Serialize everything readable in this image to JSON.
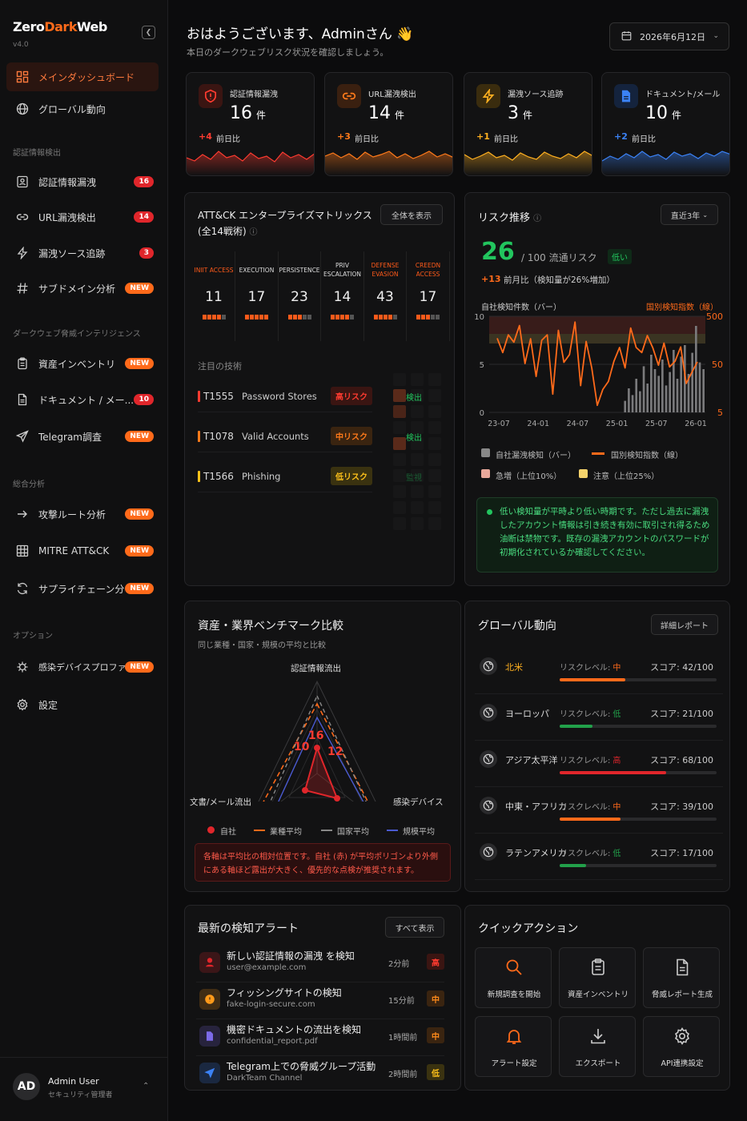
{
  "app": {
    "logo_a": "Zero",
    "logo_b": "Dark",
    "logo_c": "Web",
    "version": "v4.0"
  },
  "nav": {
    "items": [
      {
        "label": "メインダッシュボード"
      },
      {
        "label": "グローバル動向"
      },
      {
        "label": "認証情報漏洩",
        "badge": "16"
      },
      {
        "label": "URL漏洩検出",
        "badge": "14"
      },
      {
        "label": "漏洩ソース追跡",
        "badge": "3"
      },
      {
        "label": "サブドメイン分析",
        "badge": "NEW"
      },
      {
        "label": "資産インベントリ",
        "badge": "NEW"
      },
      {
        "label": "ドキュメント / メー...",
        "badge": "10"
      },
      {
        "label": "Telegram調査",
        "badge": "NEW"
      },
      {
        "label": "攻撃ルート分析",
        "badge": "NEW"
      },
      {
        "label": "MITRE ATT&CK",
        "badge": "NEW"
      },
      {
        "label": "サプライチェーン分析",
        "badge": "NEW"
      },
      {
        "label": "感染デバイスプロファイル",
        "badge": "NEW"
      },
      {
        "label": "設定"
      }
    ],
    "sections": [
      "認証情報検出",
      "ダークウェブ脅威インテリジェンス",
      "総合分析",
      "オプション"
    ]
  },
  "user": {
    "initials": "AD",
    "name": "Admin User",
    "role": "セキュリティ管理者"
  },
  "header": {
    "greeting": "おはようございます、Adminさん 👋",
    "subtitle": "本日のダークウェブリスク状況を確認しましょう。",
    "date": "2026年6月12日"
  },
  "stats": [
    {
      "title": "認証情報漏洩",
      "value": "16",
      "unit": "件",
      "delta": "+4",
      "delta_label": "前日比",
      "color": "#ff3b30"
    },
    {
      "title": "URL漏洩検出",
      "value": "14",
      "unit": "件",
      "delta": "+3",
      "delta_label": "前日比",
      "color": "#ff7a1a"
    },
    {
      "title": "漏洩ソース追跡",
      "value": "3",
      "unit": "件",
      "delta": "+1",
      "delta_label": "前日比",
      "color": "#ffb020"
    },
    {
      "title": "ドキュメント/メール",
      "value": "10",
      "unit": "件",
      "delta": "+2",
      "delta_label": "前日比",
      "color": "#3b82f6"
    }
  ],
  "attack": {
    "title": "ATT&CK エンタープライズマトリックス",
    "subtitle": "(全14戦術)",
    "button": "全体を表示",
    "tactics": [
      {
        "name": "INIIT ACCESS",
        "value": "11",
        "red": true,
        "bars": 4
      },
      {
        "name": "EXECUTION",
        "value": "17",
        "red": false,
        "bars": 5
      },
      {
        "name": "PERSISTENCE",
        "value": "23",
        "red": false,
        "bars": 3
      },
      {
        "name": "PRIV ESCALATION",
        "value": "14",
        "red": false,
        "bars": 4
      },
      {
        "name": "DEFENSE EVASION",
        "value": "43",
        "red": true,
        "bars": 4
      },
      {
        "name": "CREEDN ACCESS",
        "value": "17",
        "red": true,
        "bars": 3
      }
    ],
    "focus_title": "注目の技術",
    "techniques": [
      {
        "id": "T1555",
        "name": "Password Stores",
        "risk": "高リスク",
        "status": "検出",
        "color": "#ff3b30"
      },
      {
        "id": "T1078",
        "name": "Valid Accounts",
        "risk": "中リスク",
        "status": "検出",
        "color": "#ff7a1a"
      },
      {
        "id": "T1566",
        "name": "Phishing",
        "risk": "低リスク",
        "status": "監視",
        "color": "#ffc21a"
      }
    ]
  },
  "risk": {
    "title": "リスク推移",
    "period": "直近3年",
    "score": "26",
    "score_label": "/ 100 流通リスク",
    "level": "低い",
    "delta": "+13",
    "delta_label": "前月比（検知量が26%増加）",
    "bar_axis_label": "自社検知件数（バー）",
    "line_axis_label": "国別検知指数（線）",
    "legend": [
      "自社漏洩検知（バー）",
      "国別検知指数（線）",
      "急増（上位10%）",
      "注意（上位25%）"
    ],
    "note": "低い検知量が平時より低い時期です。ただし過去に漏洩したアカウント情報は引き続き有効に取引され得るため油断は禁物です。既存の漏洩アカウントのパスワードが初期化されているか確認してください。"
  },
  "chart_data": {
    "type": "bar",
    "x_ticks": [
      "23-07",
      "24-01",
      "24-07",
      "25-01",
      "25-07",
      "26-01"
    ],
    "y_left_ticks": [
      "0",
      "5",
      "10"
    ],
    "y_right_ticks": [
      "5",
      "50",
      "500"
    ],
    "y_right_scale": "log",
    "series": [
      {
        "name": "自社漏洩検知（バー）",
        "type": "bar",
        "values": [
          1.2,
          2.5,
          1.8,
          3.5,
          2.2,
          4.8,
          3.0,
          6.0,
          4.5,
          3.8,
          5.5,
          2.8,
          4.2,
          6.5,
          3.5,
          5.8,
          7.0,
          4.0,
          6.2,
          9.0,
          5.2,
          4.5
        ]
      },
      {
        "name": "国別検知指数（線）",
        "type": "line",
        "values": [
          175,
          88,
          205,
          145,
          320,
          52,
          170,
          28,
          158,
          205,
          12,
          255,
          55,
          80,
          380,
          18,
          150,
          42,
          7,
          15,
          22,
          58,
          112,
          42,
          285,
          112,
          88,
          198,
          110,
          48,
          138,
          44,
          58,
          115,
          20,
          34,
          56
        ]
      }
    ],
    "bands": [
      {
        "name": "急増（上位10%）",
        "color": "#e8a89a"
      },
      {
        "name": "注意（上位25%）",
        "color": "#f5d36b"
      }
    ]
  },
  "benchmark": {
    "title": "資産・業界ベンチマーク比較",
    "subtitle": "同じ業種・国家・規模の平均と比較",
    "axes": [
      "認証情報流出",
      "感染デバイス",
      "文書/メール流出"
    ],
    "self_values": [
      "16",
      "12",
      "10"
    ],
    "legend": [
      "自社",
      "業種平均",
      "国家平均",
      "規模平均"
    ],
    "note": "各軸は平均比の相対位置です。自社 (赤) が平均ポリゴンより外側にある軸ほど露出が大きく、優先的な点検が推奨されます。"
  },
  "global": {
    "title": "グローバル動向",
    "button": "詳細レポート",
    "regions": [
      {
        "name": "北米",
        "level_label": "リスクレベル:",
        "level": "中",
        "score": "スコア: 42/100",
        "pct": 42,
        "color": "#ff6a1a",
        "highlight": true
      },
      {
        "name": "ヨーロッパ",
        "level_label": "リスクレベル:",
        "level": "低",
        "score": "スコア: 21/100",
        "pct": 21,
        "color": "#22a04a",
        "highlight": false
      },
      {
        "name": "アジア太平洋",
        "level_label": "リスクレベル:",
        "level": "高",
        "score": "スコア: 68/100",
        "pct": 68,
        "color": "#e0262b",
        "highlight": false
      },
      {
        "name": "中東・アフリカ",
        "level_label": "リスクレベル:",
        "level": "中",
        "score": "スコア: 39/100",
        "pct": 39,
        "color": "#ff6a1a",
        "highlight": false
      },
      {
        "name": "ラテンアメリカ",
        "level_label": "リスクレベル:",
        "level": "低",
        "score": "スコア: 17/100",
        "pct": 17,
        "color": "#22a04a",
        "highlight": false
      }
    ]
  },
  "alerts": {
    "title": "最新の検知アラート",
    "button": "すべて表示",
    "items": [
      {
        "title": "新しい認証情報の漏洩 を検知",
        "sub": "user@example.com",
        "time": "2分前",
        "sev": "高",
        "color": "#e0262b"
      },
      {
        "title": "フィッシングサイトの検知",
        "sub": "fake-login-secure.com",
        "time": "15分前",
        "sev": "中",
        "color": "#ff9a1a"
      },
      {
        "title": "機密ドキュメントの流出を検知",
        "sub": "confidential_report.pdf",
        "time": "1時間前",
        "sev": "中",
        "color": "#7c6ae8"
      },
      {
        "title": "Telegram上での脅威グループ活動",
        "sub": "DarkTeam Channel",
        "time": "2時間前",
        "sev": "低",
        "color": "#3b82f6"
      }
    ]
  },
  "quick": {
    "title": "クイックアクション",
    "items": [
      "新規調査を開始",
      "資産インベントリ",
      "脅威レポート生成",
      "アラート設定",
      "エクスポート",
      "API連携設定"
    ]
  }
}
